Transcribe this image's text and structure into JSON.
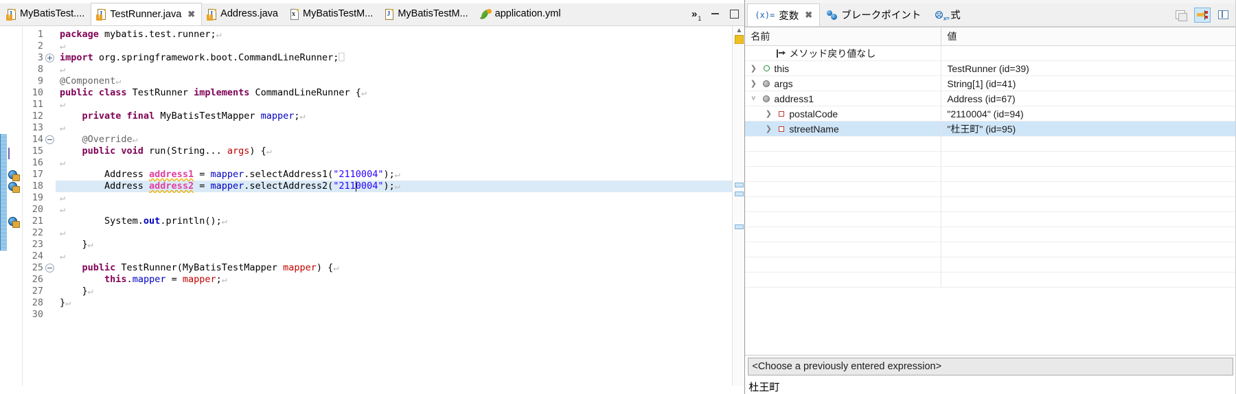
{
  "editor": {
    "tabs": [
      {
        "label": "MyBatisTest....",
        "icon": "java-file-warning-icon",
        "active": false,
        "closable": false
      },
      {
        "label": "TestRunner.java",
        "icon": "java-file-warning-icon",
        "active": true,
        "closable": true
      },
      {
        "label": "Address.java",
        "icon": "java-file-warning-icon",
        "active": false,
        "closable": false
      },
      {
        "label": "MyBatisTestM...",
        "icon": "xml-file-icon",
        "active": false,
        "closable": false
      },
      {
        "label": "MyBatisTestM...",
        "icon": "java-file-icon",
        "active": false,
        "closable": false
      },
      {
        "label": "application.yml",
        "icon": "yaml-file-icon",
        "active": false,
        "closable": false
      }
    ],
    "overflow_label": "»",
    "overflow_count": "1",
    "minimize_label": "Minimize",
    "maximize_label": "Maximize",
    "lines": [
      {
        "num": "1",
        "tokens": [
          {
            "t": "package",
            "c": "kw"
          },
          {
            "t": " mybatis.test.runner;",
            "c": "pln"
          },
          {
            "t": "↵",
            "c": "ret"
          }
        ]
      },
      {
        "num": "2",
        "tokens": [
          {
            "t": "↵",
            "c": "ret"
          }
        ]
      },
      {
        "num": "3",
        "fold": "plus",
        "tokens": [
          {
            "t": "import",
            "c": "kw"
          },
          {
            "t": " org.springframework.boot.CommandLineRunner;",
            "c": "pln"
          },
          {
            "t": "⎕",
            "c": "ret"
          }
        ]
      },
      {
        "num": "8",
        "tokens": [
          {
            "t": "↵",
            "c": "ret"
          }
        ]
      },
      {
        "num": "9",
        "tokens": [
          {
            "t": "@Component",
            "c": "ann"
          },
          {
            "t": "↵",
            "c": "ret"
          }
        ]
      },
      {
        "num": "10",
        "tokens": [
          {
            "t": "public class",
            "c": "kw"
          },
          {
            "t": " TestRunner ",
            "c": "pln"
          },
          {
            "t": "implements",
            "c": "kw"
          },
          {
            "t": " CommandLineRunner {",
            "c": "pln"
          },
          {
            "t": "↵",
            "c": "ret"
          }
        ]
      },
      {
        "num": "11",
        "tokens": [
          {
            "t": "↵",
            "c": "ret"
          }
        ]
      },
      {
        "num": "12",
        "tokens": [
          {
            "t": "    ",
            "c": "pln"
          },
          {
            "t": "private final",
            "c": "kw"
          },
          {
            "t": " MyBatisTestMapper ",
            "c": "pln"
          },
          {
            "t": "mapper",
            "c": "fld"
          },
          {
            "t": ";",
            "c": "pln"
          },
          {
            "t": "↵",
            "c": "ret"
          }
        ]
      },
      {
        "num": "13",
        "tokens": [
          {
            "t": "↵",
            "c": "ret"
          }
        ]
      },
      {
        "num": "14",
        "fold": "minus",
        "tokens": [
          {
            "t": "    ",
            "c": "pln"
          },
          {
            "t": "@Override",
            "c": "ann"
          },
          {
            "t": "↵",
            "c": "ret"
          }
        ]
      },
      {
        "num": "15",
        "tokens": [
          {
            "t": "    ",
            "c": "pln"
          },
          {
            "t": "public void",
            "c": "kw"
          },
          {
            "t": " run(String... ",
            "c": "pln"
          },
          {
            "t": "args",
            "c": "loc"
          },
          {
            "t": ") {",
            "c": "pln"
          },
          {
            "t": "↵",
            "c": "ret"
          }
        ]
      },
      {
        "num": "16",
        "tokens": [
          {
            "t": "↵",
            "c": "ret"
          }
        ]
      },
      {
        "num": "17",
        "breakpoint": true,
        "tokens": [
          {
            "t": "        Address ",
            "c": "pln"
          },
          {
            "t": "address1",
            "c": "locdecl"
          },
          {
            "t": " = ",
            "c": "pln"
          },
          {
            "t": "mapper",
            "c": "fld"
          },
          {
            "t": ".selectAddress1(",
            "c": "pln"
          },
          {
            "t": "\"2110004\"",
            "c": "str"
          },
          {
            "t": ");",
            "c": "pln"
          },
          {
            "t": "↵",
            "c": "ret"
          }
        ]
      },
      {
        "num": "18",
        "breakpoint": true,
        "exec": true,
        "current": true,
        "tokens": [
          {
            "t": "        Address ",
            "c": "pln"
          },
          {
            "t": "address2",
            "c": "locdecl"
          },
          {
            "t": " = ",
            "c": "pln"
          },
          {
            "t": "mapper",
            "c": "fld"
          },
          {
            "t": ".selectAddress2(",
            "c": "pln"
          },
          {
            "t": "\"2110004\"",
            "c": "str"
          },
          {
            "t": ");",
            "c": "pln"
          },
          {
            "t": "↵",
            "c": "ret"
          }
        ]
      },
      {
        "num": "19",
        "tokens": [
          {
            "t": "↵",
            "c": "ret"
          }
        ]
      },
      {
        "num": "20",
        "tokens": [
          {
            "t": "↵",
            "c": "ret"
          }
        ]
      },
      {
        "num": "21",
        "breakpoint": true,
        "tokens": [
          {
            "t": "        System.",
            "c": "pln"
          },
          {
            "t": "out",
            "c": "sfld"
          },
          {
            "t": ".println();",
            "c": "pln"
          },
          {
            "t": "↵",
            "c": "ret"
          }
        ]
      },
      {
        "num": "22",
        "tokens": [
          {
            "t": "↵",
            "c": "ret"
          }
        ]
      },
      {
        "num": "23",
        "tokens": [
          {
            "t": "    }",
            "c": "pln"
          },
          {
            "t": "↵",
            "c": "ret"
          }
        ]
      },
      {
        "num": "24",
        "tokens": [
          {
            "t": "↵",
            "c": "ret"
          }
        ]
      },
      {
        "num": "25",
        "fold": "minus",
        "tokens": [
          {
            "t": "    ",
            "c": "pln"
          },
          {
            "t": "public",
            "c": "kw"
          },
          {
            "t": " TestRunner(MyBatisTestMapper ",
            "c": "pln"
          },
          {
            "t": "mapper",
            "c": "loc"
          },
          {
            "t": ") {",
            "c": "pln"
          },
          {
            "t": "↵",
            "c": "ret"
          }
        ]
      },
      {
        "num": "26",
        "tokens": [
          {
            "t": "        ",
            "c": "pln"
          },
          {
            "t": "this",
            "c": "kw"
          },
          {
            "t": ".",
            "c": "pln"
          },
          {
            "t": "mapper",
            "c": "fld"
          },
          {
            "t": " = ",
            "c": "pln"
          },
          {
            "t": "mapper",
            "c": "loc"
          },
          {
            "t": ";",
            "c": "pln"
          },
          {
            "t": "↵",
            "c": "ret"
          }
        ]
      },
      {
        "num": "27",
        "tokens": [
          {
            "t": "    }",
            "c": "pln"
          },
          {
            "t": "↵",
            "c": "ret"
          }
        ]
      },
      {
        "num": "28",
        "tokens": [
          {
            "t": "}",
            "c": "pln"
          },
          {
            "t": "↵",
            "c": "ret"
          }
        ]
      },
      {
        "num": "30",
        "tokens": []
      }
    ]
  },
  "debug": {
    "tabs": [
      {
        "label": "変数",
        "icon": "variables-icon",
        "active": true,
        "closable": true
      },
      {
        "label": "ブレークポイント",
        "icon": "breakpoints-icon",
        "active": false,
        "closable": false
      },
      {
        "label": "式",
        "icon": "expressions-icon",
        "active": false,
        "closable": false
      }
    ],
    "toolbar": [
      {
        "name": "collapse-all-button",
        "selected": false
      },
      {
        "name": "show-logical-structure-button",
        "selected": true
      },
      {
        "name": "view-menu-button",
        "selected": false
      }
    ],
    "columns": [
      "名前",
      "値"
    ],
    "rows": [
      {
        "name": "メソッド戻り値なし",
        "value": "",
        "indent": 1,
        "twisty": "",
        "icon": "method-return-icon",
        "selected": false
      },
      {
        "name": "this",
        "value": "TestRunner  (id=39)",
        "indent": 0,
        "twisty": "collapsed",
        "icon": "this-object-icon",
        "selected": false
      },
      {
        "name": "args",
        "value": "String[1]  (id=41)",
        "indent": 0,
        "twisty": "collapsed",
        "icon": "local-variable-icon",
        "selected": false
      },
      {
        "name": "address1",
        "value": "Address  (id=67)",
        "indent": 0,
        "twisty": "expanded",
        "icon": "local-variable-icon",
        "selected": false
      },
      {
        "name": "postalCode",
        "value": "\"2110004\" (id=94)",
        "indent": 1,
        "twisty": "collapsed",
        "icon": "field-icon",
        "selected": false
      },
      {
        "name": "streetName",
        "value": "\"杜王町\" (id=95)",
        "indent": 1,
        "twisty": "collapsed",
        "icon": "field-icon",
        "selected": true
      },
      {
        "name": "",
        "value": "",
        "indent": 0,
        "twisty": "",
        "icon": "",
        "selected": false
      },
      {
        "name": "",
        "value": "",
        "indent": 0,
        "twisty": "",
        "icon": "",
        "selected": false
      },
      {
        "name": "",
        "value": "",
        "indent": 0,
        "twisty": "",
        "icon": "",
        "selected": false
      },
      {
        "name": "",
        "value": "",
        "indent": 0,
        "twisty": "",
        "icon": "",
        "selected": false
      },
      {
        "name": "",
        "value": "",
        "indent": 0,
        "twisty": "",
        "icon": "",
        "selected": false
      },
      {
        "name": "",
        "value": "",
        "indent": 0,
        "twisty": "",
        "icon": "",
        "selected": false
      },
      {
        "name": "",
        "value": "",
        "indent": 0,
        "twisty": "",
        "icon": "",
        "selected": false
      },
      {
        "name": "",
        "value": "",
        "indent": 0,
        "twisty": "",
        "icon": "",
        "selected": false
      },
      {
        "name": "",
        "value": "",
        "indent": 0,
        "twisty": "",
        "icon": "",
        "selected": false
      },
      {
        "name": "",
        "value": "",
        "indent": 0,
        "twisty": "",
        "icon": "",
        "selected": false
      }
    ],
    "expression_placeholder": "<Choose a previously entered expression>",
    "detail_value": "杜王町"
  },
  "colors": {
    "exec_line": "#c5e0a5",
    "selected_row": "#cfe5f8",
    "current_line": "#dbeaf7",
    "keyword": "#7f0055",
    "string": "#2a00ff",
    "field": "#0000c0",
    "local": "#c00000",
    "local_decl": "#e040a0"
  }
}
